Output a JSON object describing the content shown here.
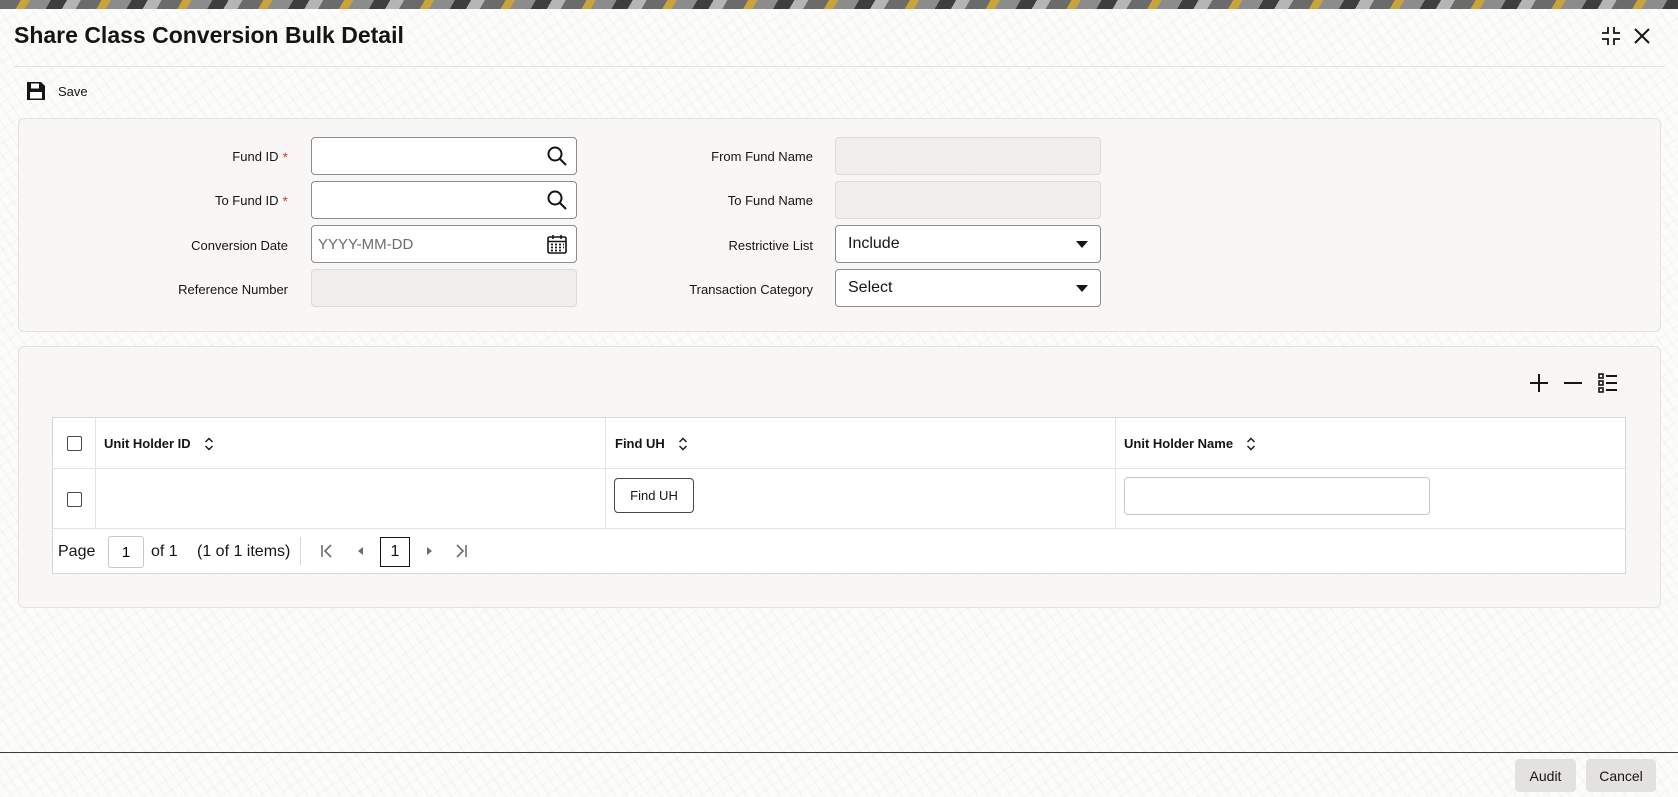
{
  "window": {
    "title": "Share Class Conversion Bulk Detail"
  },
  "toolbar": {
    "save_label": "Save"
  },
  "form": {
    "fund_id_label": "Fund ID",
    "to_fund_id_label": "To Fund ID",
    "conversion_date_label": "Conversion Date",
    "conversion_date_placeholder": "YYYY-MM-DD",
    "reference_number_label": "Reference Number",
    "from_fund_name_label": "From Fund Name",
    "to_fund_name_label": "To Fund Name",
    "restrictive_list_label": "Restrictive List",
    "restrictive_list_value": "Include",
    "transaction_category_label": "Transaction Category",
    "transaction_category_value": "Select",
    "required_marker": "*"
  },
  "table": {
    "columns": [
      "Unit Holder ID",
      "Find UH",
      "Unit Holder Name"
    ],
    "row_button_label": "Find UH",
    "pager": {
      "page_label": "Page",
      "page_value": "1",
      "of_label": "of 1",
      "items_label": "(1 of 1 items)",
      "current_page": "1"
    }
  },
  "footer": {
    "audit_label": "Audit",
    "cancel_label": "Cancel"
  },
  "colors": {
    "required": "#c74634",
    "text": "#161513",
    "panel": "#f7f6f4"
  }
}
